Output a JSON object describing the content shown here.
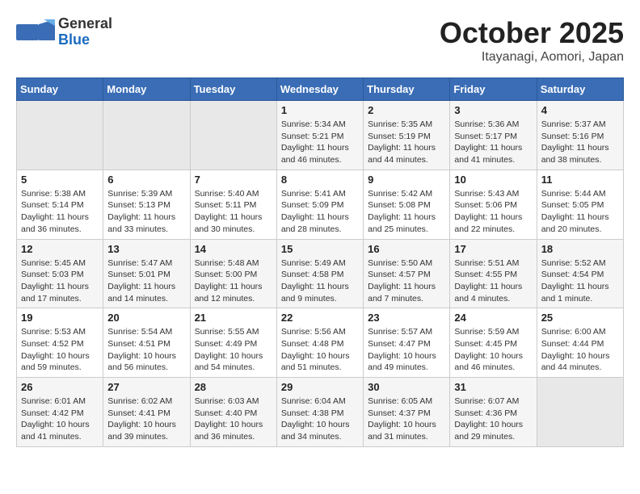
{
  "header": {
    "logo_general": "General",
    "logo_blue": "Blue",
    "month_year": "October 2025",
    "location": "Itayanagi, Aomori, Japan"
  },
  "weekdays": [
    "Sunday",
    "Monday",
    "Tuesday",
    "Wednesday",
    "Thursday",
    "Friday",
    "Saturday"
  ],
  "weeks": [
    [
      {
        "day": "",
        "empty": true
      },
      {
        "day": "",
        "empty": true
      },
      {
        "day": "",
        "empty": true
      },
      {
        "day": "1",
        "sunrise": "5:34 AM",
        "sunset": "5:21 PM",
        "daylight": "11 hours and 46 minutes."
      },
      {
        "day": "2",
        "sunrise": "5:35 AM",
        "sunset": "5:19 PM",
        "daylight": "11 hours and 44 minutes."
      },
      {
        "day": "3",
        "sunrise": "5:36 AM",
        "sunset": "5:17 PM",
        "daylight": "11 hours and 41 minutes."
      },
      {
        "day": "4",
        "sunrise": "5:37 AM",
        "sunset": "5:16 PM",
        "daylight": "11 hours and 38 minutes."
      }
    ],
    [
      {
        "day": "5",
        "sunrise": "5:38 AM",
        "sunset": "5:14 PM",
        "daylight": "11 hours and 36 minutes."
      },
      {
        "day": "6",
        "sunrise": "5:39 AM",
        "sunset": "5:13 PM",
        "daylight": "11 hours and 33 minutes."
      },
      {
        "day": "7",
        "sunrise": "5:40 AM",
        "sunset": "5:11 PM",
        "daylight": "11 hours and 30 minutes."
      },
      {
        "day": "8",
        "sunrise": "5:41 AM",
        "sunset": "5:09 PM",
        "daylight": "11 hours and 28 minutes."
      },
      {
        "day": "9",
        "sunrise": "5:42 AM",
        "sunset": "5:08 PM",
        "daylight": "11 hours and 25 minutes."
      },
      {
        "day": "10",
        "sunrise": "5:43 AM",
        "sunset": "5:06 PM",
        "daylight": "11 hours and 22 minutes."
      },
      {
        "day": "11",
        "sunrise": "5:44 AM",
        "sunset": "5:05 PM",
        "daylight": "11 hours and 20 minutes."
      }
    ],
    [
      {
        "day": "12",
        "sunrise": "5:45 AM",
        "sunset": "5:03 PM",
        "daylight": "11 hours and 17 minutes."
      },
      {
        "day": "13",
        "sunrise": "5:47 AM",
        "sunset": "5:01 PM",
        "daylight": "11 hours and 14 minutes."
      },
      {
        "day": "14",
        "sunrise": "5:48 AM",
        "sunset": "5:00 PM",
        "daylight": "11 hours and 12 minutes."
      },
      {
        "day": "15",
        "sunrise": "5:49 AM",
        "sunset": "4:58 PM",
        "daylight": "11 hours and 9 minutes."
      },
      {
        "day": "16",
        "sunrise": "5:50 AM",
        "sunset": "4:57 PM",
        "daylight": "11 hours and 7 minutes."
      },
      {
        "day": "17",
        "sunrise": "5:51 AM",
        "sunset": "4:55 PM",
        "daylight": "11 hours and 4 minutes."
      },
      {
        "day": "18",
        "sunrise": "5:52 AM",
        "sunset": "4:54 PM",
        "daylight": "11 hours and 1 minute."
      }
    ],
    [
      {
        "day": "19",
        "sunrise": "5:53 AM",
        "sunset": "4:52 PM",
        "daylight": "10 hours and 59 minutes."
      },
      {
        "day": "20",
        "sunrise": "5:54 AM",
        "sunset": "4:51 PM",
        "daylight": "10 hours and 56 minutes."
      },
      {
        "day": "21",
        "sunrise": "5:55 AM",
        "sunset": "4:49 PM",
        "daylight": "10 hours and 54 minutes."
      },
      {
        "day": "22",
        "sunrise": "5:56 AM",
        "sunset": "4:48 PM",
        "daylight": "10 hours and 51 minutes."
      },
      {
        "day": "23",
        "sunrise": "5:57 AM",
        "sunset": "4:47 PM",
        "daylight": "10 hours and 49 minutes."
      },
      {
        "day": "24",
        "sunrise": "5:59 AM",
        "sunset": "4:45 PM",
        "daylight": "10 hours and 46 minutes."
      },
      {
        "day": "25",
        "sunrise": "6:00 AM",
        "sunset": "4:44 PM",
        "daylight": "10 hours and 44 minutes."
      }
    ],
    [
      {
        "day": "26",
        "sunrise": "6:01 AM",
        "sunset": "4:42 PM",
        "daylight": "10 hours and 41 minutes."
      },
      {
        "day": "27",
        "sunrise": "6:02 AM",
        "sunset": "4:41 PM",
        "daylight": "10 hours and 39 minutes."
      },
      {
        "day": "28",
        "sunrise": "6:03 AM",
        "sunset": "4:40 PM",
        "daylight": "10 hours and 36 minutes."
      },
      {
        "day": "29",
        "sunrise": "6:04 AM",
        "sunset": "4:38 PM",
        "daylight": "10 hours and 34 minutes."
      },
      {
        "day": "30",
        "sunrise": "6:05 AM",
        "sunset": "4:37 PM",
        "daylight": "10 hours and 31 minutes."
      },
      {
        "day": "31",
        "sunrise": "6:07 AM",
        "sunset": "4:36 PM",
        "daylight": "10 hours and 29 minutes."
      },
      {
        "day": "",
        "empty": true
      }
    ]
  ],
  "labels": {
    "sunrise": "Sunrise:",
    "sunset": "Sunset:",
    "daylight": "Daylight:"
  }
}
